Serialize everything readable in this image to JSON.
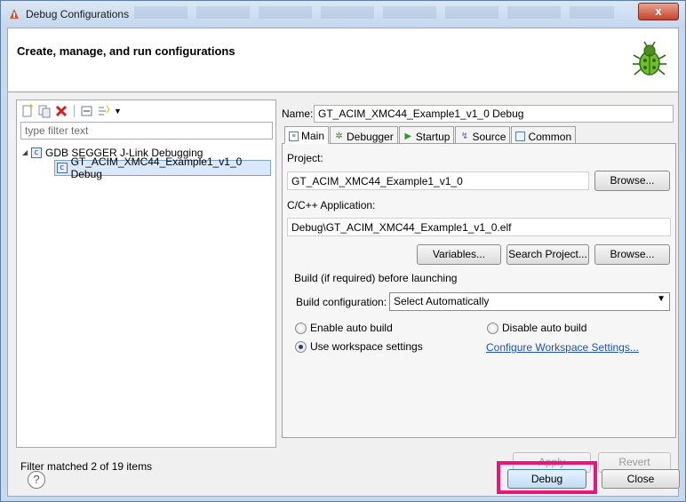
{
  "window": {
    "title": "Debug Configurations",
    "close_glyph": "x"
  },
  "header": {
    "title": "Create, manage, and run configurations",
    "icon": "bug-icon"
  },
  "left": {
    "filter_placeholder": "type filter text",
    "tree": {
      "group_label": "GDB SEGGER J-Link Debugging",
      "item_label": "GT_ACIM_XMC44_Example1_v1_0 Debug"
    },
    "status": "Filter matched 2 of 19 items"
  },
  "right": {
    "name_label": "Name:",
    "name_value": "GT_ACIM_XMC44_Example1_v1_0 Debug",
    "tabs": [
      {
        "label": "Main",
        "icon": "main-tab-icon"
      },
      {
        "label": "Debugger",
        "icon": "debugger-tab-icon"
      },
      {
        "label": "Startup",
        "icon": "startup-tab-icon"
      },
      {
        "label": "Source",
        "icon": "source-tab-icon"
      },
      {
        "label": "Common",
        "icon": "common-tab-icon"
      }
    ],
    "project_label": "Project:",
    "project_value": "GT_ACIM_XMC44_Example1_v1_0",
    "app_label": "C/C++ Application:",
    "app_value": "Debug\\GT_ACIM_XMC44_Example1_v1_0.elf",
    "browse_label": "Browse...",
    "variables_label": "Variables...",
    "search_project_label": "Search Project...",
    "build_group_label": "Build (if required) before launching",
    "build_config_label": "Build configuration:",
    "build_config_value": "Select Automatically",
    "enable_auto_build": "Enable auto build",
    "disable_auto_build": "Disable auto build",
    "use_workspace": "Use workspace settings",
    "configure_link": "Configure Workspace Settings...",
    "selected_radio": "use_workspace",
    "apply_label": "Apply",
    "revert_label": "Revert"
  },
  "footer": {
    "help_glyph": "?",
    "debug_label": "Debug",
    "close_label": "Close",
    "highlight_color": "#e8157c"
  }
}
